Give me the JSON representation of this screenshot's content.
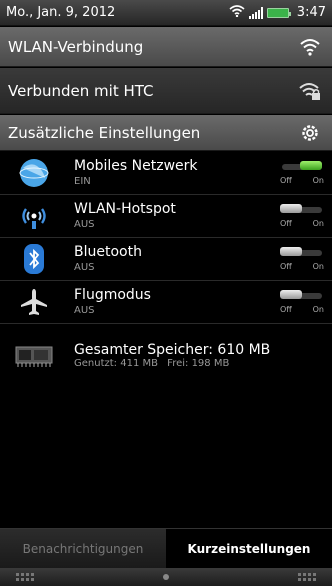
{
  "status_bar": {
    "date": "Mo., Jan. 9, 2012",
    "time": "3:47"
  },
  "wlan_header": {
    "label": "WLAN-Verbindung",
    "icon": "wifi-icon"
  },
  "connected_row": {
    "label": "Verbunden mit HTC",
    "icon": "wifi-lock-icon"
  },
  "extra_settings": {
    "label": "Zusätzliche Einstellungen",
    "icon": "gear-icon"
  },
  "toggles": [
    {
      "title": "Mobiles Netzwerk",
      "status": "EIN",
      "on": true,
      "icon": "globe-icon",
      "off_label": "Off",
      "on_label": "On"
    },
    {
      "title": "WLAN-Hotspot",
      "status": "AUS",
      "on": false,
      "icon": "hotspot-icon",
      "off_label": "Off",
      "on_label": "On"
    },
    {
      "title": "Bluetooth",
      "status": "AUS",
      "on": false,
      "icon": "bluetooth-icon",
      "off_label": "Off",
      "on_label": "On"
    },
    {
      "title": "Flugmodus",
      "status": "AUS",
      "on": false,
      "icon": "airplane-icon",
      "off_label": "Off",
      "on_label": "On"
    }
  ],
  "memory": {
    "title": "Gesamter Speicher: 610 MB",
    "used": "Genutzt: 411 MB",
    "free": "Frei: 198 MB",
    "icon": "memory-chip-icon"
  },
  "tabs": {
    "notifications": "Benachrichtigungen",
    "quick_settings": "Kurzeinstellungen"
  }
}
